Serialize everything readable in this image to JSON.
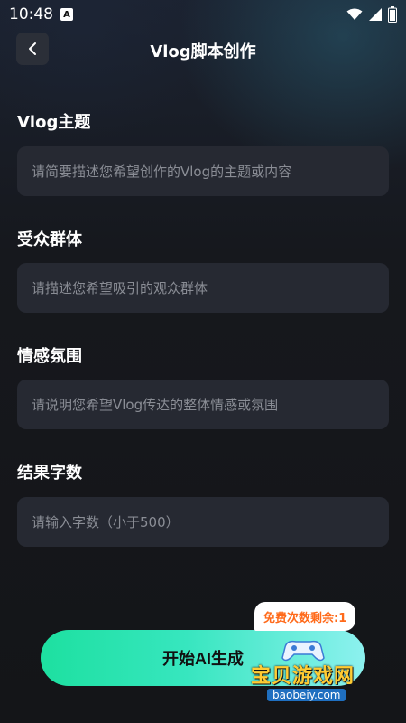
{
  "status_bar": {
    "time": "10:48",
    "notification_badge": "A"
  },
  "header": {
    "title": "Vlog脚本创作"
  },
  "fields": [
    {
      "label": "Vlog主题",
      "placeholder": "请简要描述您希望创作的Vlog的主题或内容"
    },
    {
      "label": "受众群体",
      "placeholder": "请描述您希望吸引的观众群体"
    },
    {
      "label": "情感氛围",
      "placeholder": "请说明您希望Vlog传达的整体情感或氛围"
    },
    {
      "label": "结果字数",
      "placeholder": "请输入字数（小于500）"
    }
  ],
  "actions": {
    "generate_label": "开始AI生成",
    "free_uses_label": "免费次数剩余:1"
  },
  "watermark": {
    "title": "宝贝游戏网",
    "url": "baobeiy.com"
  },
  "colors": {
    "accent_start": "#1de0a0",
    "accent_end": "#8df1ef",
    "badge_text": "#ff6a1a",
    "input_bg": "#262932"
  },
  "icons": {
    "back": "chevron-left-icon",
    "wifi": "wifi-icon",
    "signal": "signal-icon",
    "battery": "battery-icon"
  }
}
